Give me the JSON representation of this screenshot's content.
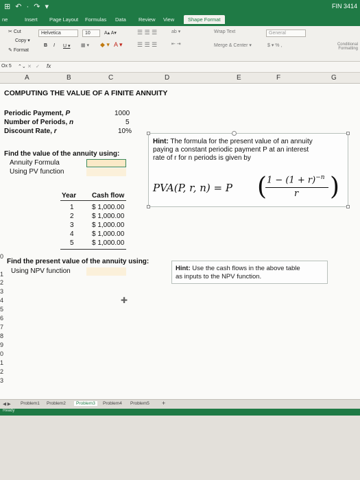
{
  "window": {
    "quick_access": "⊞ ↶ · ↷ ▾",
    "doc_name": "FIN 3414"
  },
  "ribbon_tabs": [
    "ne",
    "Insert",
    "Page Layout",
    "Formulas",
    "Data",
    "Review",
    "View",
    "Shape Format"
  ],
  "ribbon": {
    "cut": "Cut",
    "copy": "Copy ▾",
    "format": "Format",
    "font_name": "Helvetica",
    "font_size": "10",
    "grow_shrink": "A▴ A▾",
    "bold": "B",
    "italic": "I",
    "underline": "U ▾",
    "wrap_text": "Wrap Text",
    "merge_center": "Merge & Center ▾",
    "number_format": "General",
    "number_symbols": "$ ▾ %  ,",
    "conditional": "Conditional Formatting"
  },
  "formula_bar": {
    "name_box": "Ox 5",
    "stepper": "⌃⌄",
    "cancel": "✕",
    "enter": "✓",
    "fx": "fx"
  },
  "columns": [
    "A",
    "B",
    "C",
    "D",
    "E",
    "F",
    "G"
  ],
  "row_numbers": [
    "",
    "",
    "",
    "",
    "",
    "",
    "",
    "",
    "",
    "",
    "",
    "",
    "",
    "",
    "",
    "",
    "",
    "",
    "",
    "",
    "",
    "",
    "",
    "",
    "",
    "",
    "",
    "",
    "",
    "0",
    "1",
    "2",
    "3",
    "4",
    "5",
    "6",
    "7",
    "8",
    "9",
    "0",
    "1",
    "2",
    "3"
  ],
  "title": "COMPUTING THE VALUE OF A FINITE ANNUITY",
  "inputs": [
    {
      "label": "Periodic Payment, ",
      "var": "P",
      "value": "1000"
    },
    {
      "label": "Number of Periods, ",
      "var": "n",
      "value": "5"
    },
    {
      "label": "Discount Rate, ",
      "var": "r",
      "value": "10%"
    }
  ],
  "find_value": {
    "heading": "Find the value of the annuity using:",
    "opt1": "Annuity Formula",
    "opt2": "Using PV function"
  },
  "cashflow_table": {
    "headers": [
      "Year",
      "Cash flow"
    ],
    "rows": [
      [
        "1",
        "$ 1,000.00"
      ],
      [
        "2",
        "$ 1,000.00"
      ],
      [
        "3",
        "$ 1,000.00"
      ],
      [
        "4",
        "$ 1,000.00"
      ],
      [
        "5",
        "$ 1,000.00"
      ]
    ]
  },
  "hint1": {
    "label": "Hint:",
    "line1": " The formula for the present value of an annuity",
    "line2": "paying a constant periodic payment P at an interest",
    "line3": "rate of r for n periods is given by",
    "formula_lhs": "PVA(P, r, n) = P",
    "formula_num": "1 − (1 + r)",
    "formula_exp": "−n",
    "formula_den": "r"
  },
  "find_pv": {
    "heading": "Find the present value of the annuity using:",
    "opt1": "Using NPV function"
  },
  "hint2": {
    "label": "Hint:",
    "line1": " Use the cash flows in the above table",
    "line2": "as inputs to the NPV function."
  },
  "sheet_tabs": [
    "Problem1",
    "Problem2",
    "Problem3",
    "Problem4",
    "Problem5",
    "+"
  ],
  "status": "Ready"
}
